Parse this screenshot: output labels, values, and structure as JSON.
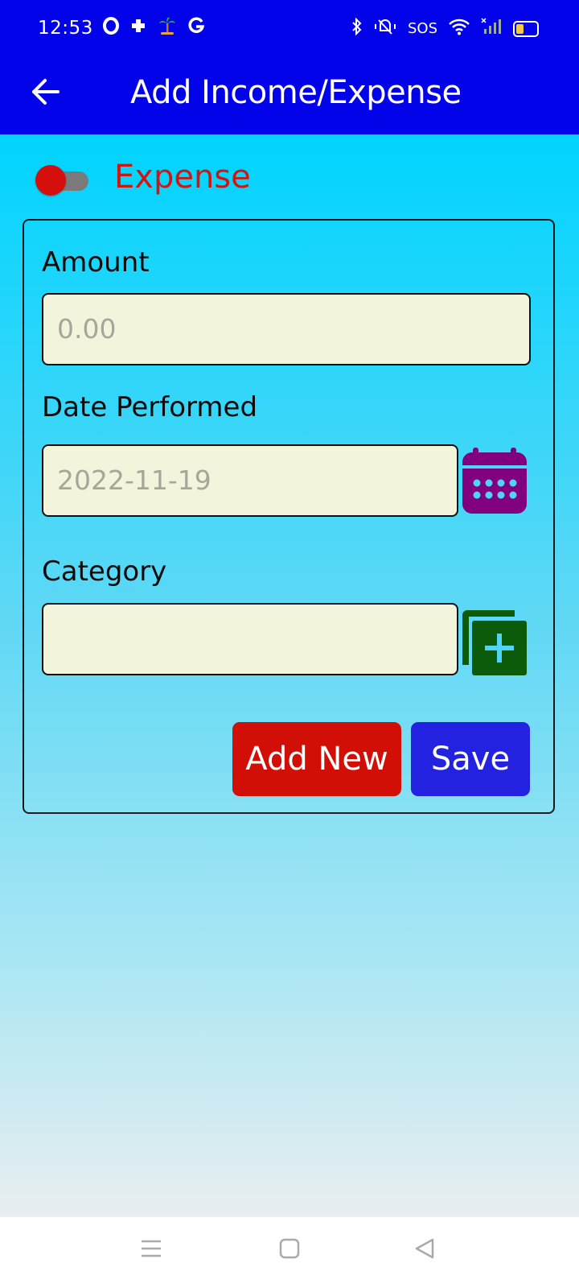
{
  "status_bar": {
    "time": "12:53",
    "sos": "SOS"
  },
  "app_bar": {
    "title": "Add Income/Expense",
    "back_icon": "arrow-left-icon"
  },
  "type_toggle": {
    "label": "Expense",
    "state": "off",
    "label_color": "#d0160f"
  },
  "form": {
    "amount": {
      "label": "Amount",
      "placeholder": "0.00",
      "value": ""
    },
    "date": {
      "label": "Date Performed",
      "placeholder": "2022-11-19",
      "value": "",
      "icon": "calendar-icon"
    },
    "category": {
      "label": "Category",
      "value": "",
      "icon": "add-category-icon"
    },
    "buttons": {
      "add_new": "Add New",
      "save": "Save"
    }
  },
  "colors": {
    "app_bar": "#0303e9",
    "add_new_button": "#d10f07",
    "save_button": "#2222e0",
    "calendar_icon": "#800080",
    "add_category_icon": "#0b5b0b",
    "field_background": "#f3f4dc"
  }
}
